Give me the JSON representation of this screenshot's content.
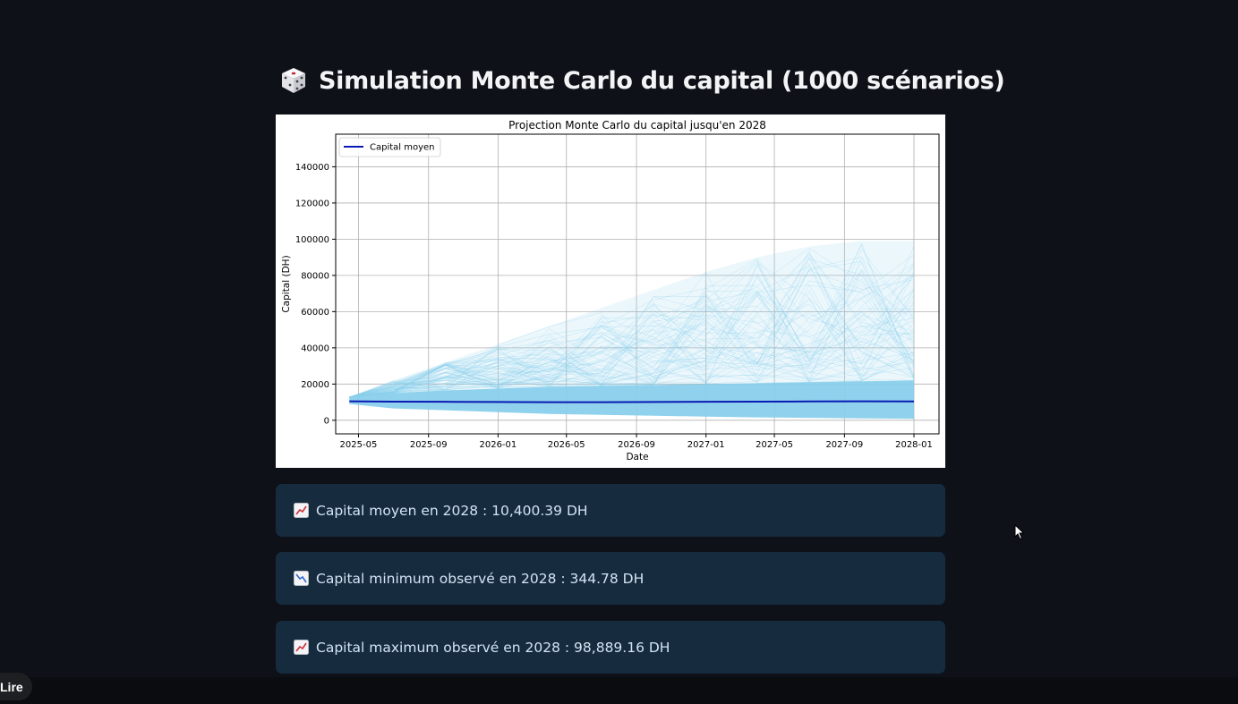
{
  "header": {
    "title": "Simulation Monte Carlo du capital (1000 scénarios)",
    "icon": "dice-icon"
  },
  "chart_data": {
    "type": "line",
    "title": "Projection Monte Carlo du capital jusqu'en 2028",
    "xlabel": "Date",
    "ylabel": "Capital (DH)",
    "x_ticks": [
      "2025-05",
      "2025-09",
      "2026-01",
      "2026-05",
      "2026-09",
      "2027-01",
      "2027-05",
      "2027-09",
      "2028-01"
    ],
    "y_ticks": [
      0,
      20000,
      40000,
      60000,
      80000,
      100000,
      120000,
      140000
    ],
    "xlim": [
      "2025-03-22",
      "2028-02-14"
    ],
    "ylim": [
      -7500,
      158000
    ],
    "x_range": [
      "2025-04-15",
      "2028-01-01"
    ],
    "grid": true,
    "legend_placement": "top-left",
    "series": [
      {
        "name": "Capital moyen",
        "color": "#0a1ab4",
        "x": [
          "2025-04-15",
          "2025-07-01",
          "2025-10-01",
          "2026-01-01",
          "2026-04-01",
          "2026-07-01",
          "2026-10-01",
          "2027-01-01",
          "2027-04-01",
          "2027-07-01",
          "2027-10-01",
          "2028-01-01"
        ],
        "values": [
          10500,
          10300,
          10200,
          10100,
          10000,
          10000,
          10100,
          10200,
          10300,
          10400,
          10500,
          10400
        ]
      }
    ],
    "simulations": {
      "count": 1000,
      "color": "#87ceeb",
      "x": [
        "2025-04-15",
        "2025-07-01",
        "2025-10-01",
        "2026-01-01",
        "2026-04-01",
        "2026-07-01",
        "2026-10-01",
        "2027-01-01",
        "2027-04-01",
        "2027-07-01",
        "2027-10-01",
        "2028-01-01"
      ],
      "dense_low": [
        9000,
        6500,
        5500,
        4500,
        3500,
        3000,
        2500,
        2000,
        1600,
        1300,
        1000,
        800
      ],
      "dense_high": [
        12500,
        15000,
        16500,
        17500,
        18500,
        19000,
        19500,
        20000,
        20500,
        21000,
        21500,
        22000
      ],
      "envelope_high": [
        13000,
        22000,
        32000,
        42000,
        52000,
        62000,
        72000,
        82000,
        90000,
        96000,
        99000,
        99000
      ]
    }
  },
  "metrics": [
    {
      "icon": "chart-increasing-icon",
      "text": "Capital moyen en 2028 : 10,400.39 DH"
    },
    {
      "icon": "chart-decreasing-icon",
      "text": "Capital minimum observé en 2028 : 344.78 DH"
    },
    {
      "icon": "chart-increasing-icon",
      "text": "Capital maximum observé en 2028 : 98,889.16 DH"
    }
  ],
  "player": {
    "play_label": "Lire"
  }
}
